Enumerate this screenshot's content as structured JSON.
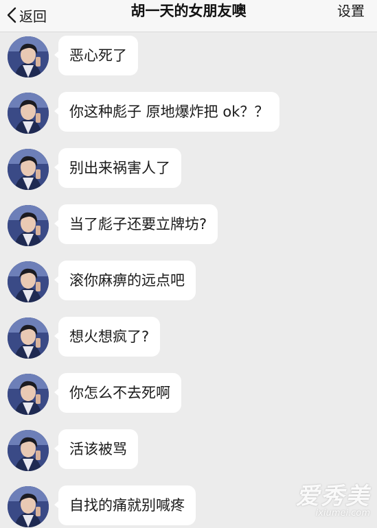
{
  "nav": {
    "back_label": "返回",
    "title": "胡一天的女朋友噢",
    "settings_label": "设置"
  },
  "messages": [
    {
      "text": "恶心死了"
    },
    {
      "text": "你这种彪子 原地爆炸把 ok？？"
    },
    {
      "text": "别出来祸害人了"
    },
    {
      "text": "当了彪子还要立牌坊?"
    },
    {
      "text": "滚你麻痹的远点吧"
    },
    {
      "text": "想火想疯了?"
    },
    {
      "text": "你怎么不去死啊"
    },
    {
      "text": "活该被骂"
    },
    {
      "text": "自找的痛就别喊疼"
    }
  ],
  "watermark": {
    "main": "爱秀美",
    "sub": "ixiumei.com"
  },
  "colors": {
    "background": "#ececec",
    "nav_background": "#f7f7f7",
    "bubble": "#ffffff",
    "text": "#1a1a1a"
  }
}
